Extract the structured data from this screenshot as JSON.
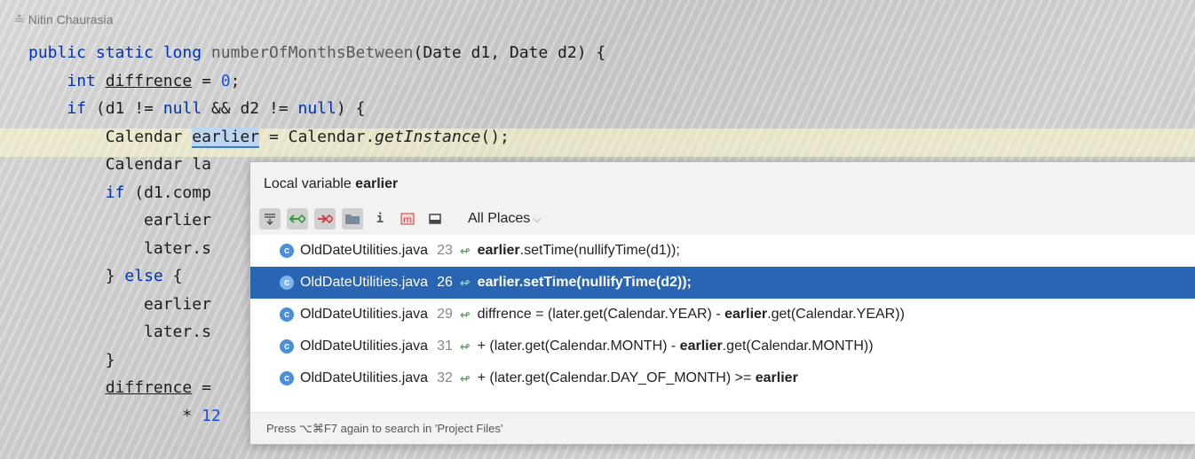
{
  "author": "Nitin Chaurasia",
  "code": {
    "line1_kw": "public static long",
    "line1_fn": "numberOfMonthsBetween",
    "line1_rest": "(Date d1, Date d2) {",
    "line2_kw": "int",
    "line2_var": "diffrence",
    "line2_eq": " = ",
    "line2_num": "0",
    "line2_end": ";",
    "line3_kw": "if",
    "line3_a": " (d1 != ",
    "line3_null1": "null",
    "line3_b": " && d2 != ",
    "line3_null2": "null",
    "line3_c": ") {",
    "line4_a": "Calendar ",
    "line4_sel": "earlier",
    "line4_b": " = Calendar.",
    "line4_it": "getInstance",
    "line4_c": "();",
    "line5": "Calendar la",
    "line6_kw": "if",
    "line6_rest": " (d1.comp",
    "line7": "earlier",
    "line8": "later.s",
    "line9_a": "} ",
    "line9_kw": "else",
    "line9_b": " {",
    "line10": "earlier",
    "line11": "later.s",
    "line12": "}",
    "line13_var": "diffrence",
    "line13_rest": " =",
    "line14_a": "* ",
    "line14_num": "12"
  },
  "popup": {
    "title_prefix": "Local variable ",
    "title_var": "earlier",
    "scope": "All Places",
    "rows": [
      {
        "file": "OldDateUtilities.java",
        "line": "23",
        "pre": "",
        "bold": "earlier",
        "post": ".setTime(nullifyTime(d1));"
      },
      {
        "file": "OldDateUtilities.java",
        "line": "26",
        "pre": "",
        "bold": "earlier",
        "post": ".setTime(nullifyTime(d2));"
      },
      {
        "file": "OldDateUtilities.java",
        "line": "29",
        "pre": "diffrence = (later.get(Calendar.YEAR) - ",
        "bold": "earlier",
        "post": ".get(Calendar.YEAR))"
      },
      {
        "file": "OldDateUtilities.java",
        "line": "31",
        "pre": "+ (later.get(Calendar.MONTH) - ",
        "bold": "earlier",
        "post": ".get(Calendar.MONTH))"
      },
      {
        "file": "OldDateUtilities.java",
        "line": "32",
        "pre": "+ (later.get(Calendar.DAY_OF_MONTH) >= ",
        "bold": "earlier",
        "post": ""
      }
    ],
    "footer": "Press ⌥⌘F7 again to search in 'Project Files'"
  }
}
